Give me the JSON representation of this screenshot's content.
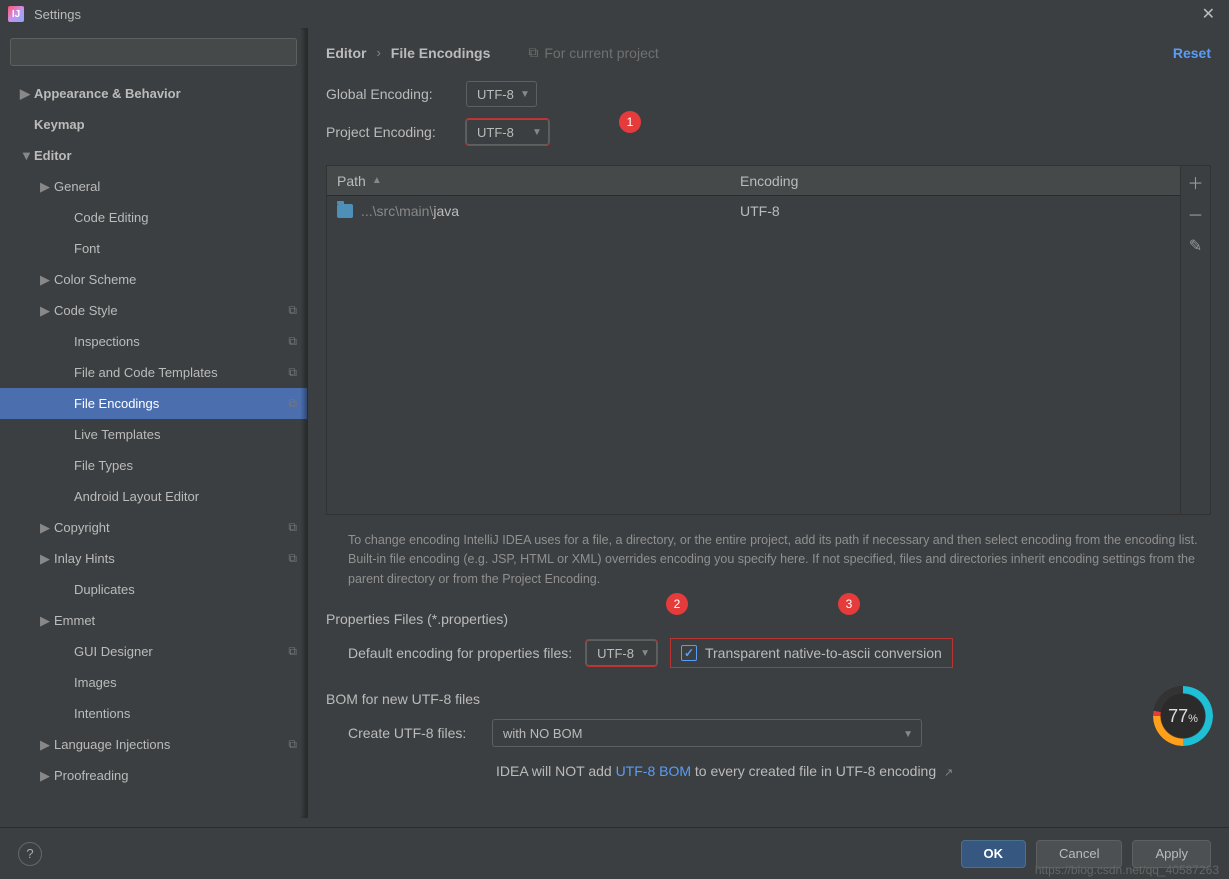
{
  "window": {
    "title": "Settings"
  },
  "sidebar": {
    "search_placeholder": "",
    "items": [
      {
        "label": "Appearance & Behavior",
        "caret": "▶",
        "bold": true,
        "lvl": 0
      },
      {
        "label": "Keymap",
        "caret": "",
        "bold": true,
        "lvl": 0
      },
      {
        "label": "Editor",
        "caret": "▼",
        "bold": true,
        "lvl": 0
      },
      {
        "label": "General",
        "caret": "▶",
        "lvl": 1
      },
      {
        "label": "Code Editing",
        "lvl": 2
      },
      {
        "label": "Font",
        "lvl": 2
      },
      {
        "label": "Color Scheme",
        "caret": "▶",
        "lvl": 1
      },
      {
        "label": "Code Style",
        "caret": "▶",
        "lvl": 1,
        "copy": true
      },
      {
        "label": "Inspections",
        "lvl": 2,
        "copy": true
      },
      {
        "label": "File and Code Templates",
        "lvl": 2,
        "copy": true
      },
      {
        "label": "File Encodings",
        "lvl": 2,
        "copy": true,
        "selected": true
      },
      {
        "label": "Live Templates",
        "lvl": 2
      },
      {
        "label": "File Types",
        "lvl": 2
      },
      {
        "label": "Android Layout Editor",
        "lvl": 2
      },
      {
        "label": "Copyright",
        "caret": "▶",
        "lvl": 1,
        "copy": true
      },
      {
        "label": "Inlay Hints",
        "caret": "▶",
        "lvl": 1,
        "copy": true
      },
      {
        "label": "Duplicates",
        "lvl": 2
      },
      {
        "label": "Emmet",
        "caret": "▶",
        "lvl": 1
      },
      {
        "label": "GUI Designer",
        "lvl": 2,
        "copy": true
      },
      {
        "label": "Images",
        "lvl": 2
      },
      {
        "label": "Intentions",
        "lvl": 2
      },
      {
        "label": "Language Injections",
        "caret": "▶",
        "lvl": 1,
        "copy": true
      },
      {
        "label": "Proofreading",
        "caret": "▶",
        "lvl": 1
      }
    ]
  },
  "breadcrumb": {
    "a": "Editor",
    "b": "File Encodings",
    "scope": "For current project",
    "reset": "Reset"
  },
  "global": {
    "label": "Global Encoding:",
    "value": "UTF-8"
  },
  "project": {
    "label": "Project Encoding:",
    "value": "UTF-8"
  },
  "annotations": {
    "b1": "1",
    "b2": "2",
    "b3": "3"
  },
  "table": {
    "col_path": "Path",
    "col_enc": "Encoding",
    "row_path_dim": "...\\src\\main\\",
    "row_path_bright": "java",
    "row_enc": "UTF-8"
  },
  "hint": "To change encoding IntelliJ IDEA uses for a file, a directory, or the entire project, add its path if necessary and then select encoding from the encoding list. Built-in file encoding (e.g. JSP, HTML or XML) overrides encoding you specify here. If not specified, files and directories inherit encoding settings from the parent directory or from the Project Encoding.",
  "props": {
    "section": "Properties Files (*.properties)",
    "label": "Default encoding for properties files:",
    "value": "UTF-8",
    "check_label": "Transparent native-to-ascii conversion"
  },
  "bom": {
    "section": "BOM for new UTF-8 files",
    "label": "Create UTF-8 files:",
    "value": "with NO BOM",
    "info_pre": "IDEA will NOT add ",
    "info_link": "UTF-8 BOM",
    "info_post": " to every created file in UTF-8 encoding"
  },
  "gauge": {
    "value": "77",
    "unit": "%"
  },
  "footer": {
    "ok": "OK",
    "cancel": "Cancel",
    "apply": "Apply"
  },
  "watermark": "https://blog.csdn.net/qq_40587263"
}
